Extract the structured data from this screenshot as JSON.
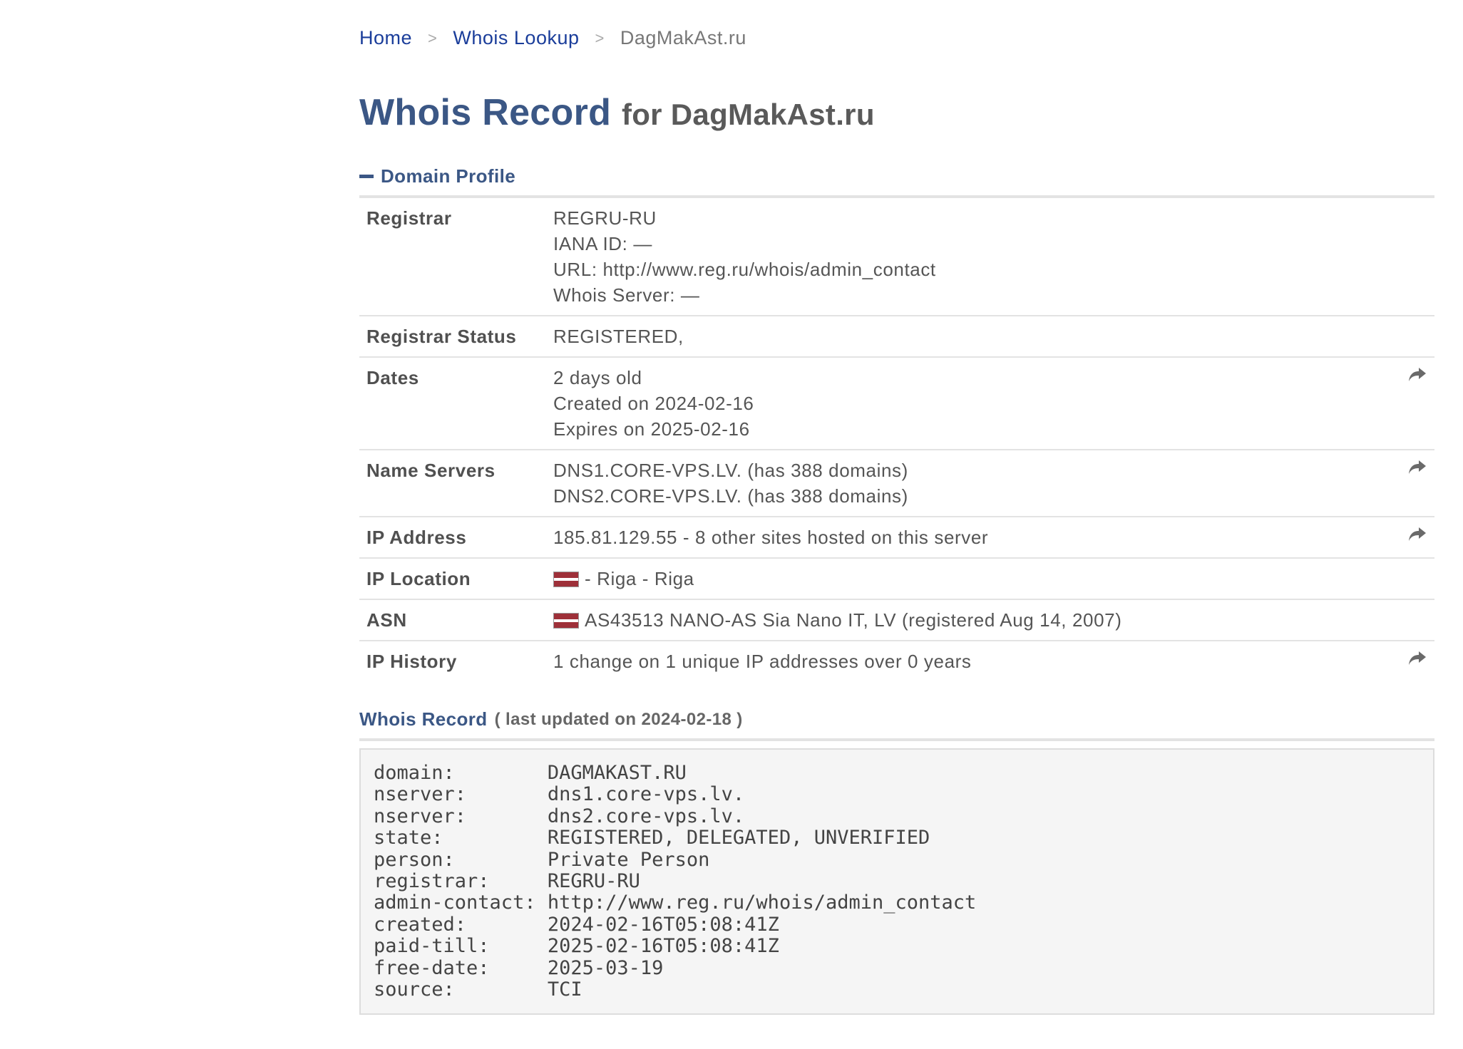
{
  "breadcrumb": {
    "home": "Home",
    "sep": ">",
    "whois_lookup": "Whois Lookup",
    "current": "DagMakAst.ru"
  },
  "title": {
    "main": "Whois Record",
    "sub": "for DagMakAst.ru"
  },
  "domain_profile": {
    "heading": "Domain Profile",
    "rows": {
      "registrar": {
        "label": "Registrar",
        "lines": [
          "REGRU-RU",
          "IANA ID: —",
          "URL: http://www.reg.ru/whois/admin_contact",
          "Whois Server: —"
        ]
      },
      "registrar_status": {
        "label": "Registrar Status",
        "value": "REGISTERED,"
      },
      "dates": {
        "label": "Dates",
        "lines": [
          "2 days old",
          "Created on 2024-02-16",
          "Expires on 2025-02-16"
        ]
      },
      "name_servers": {
        "label": "Name Servers",
        "lines": [
          "DNS1.CORE-VPS.LV. (has 388 domains)",
          "DNS2.CORE-VPS.LV. (has 388 domains)"
        ]
      },
      "ip_address": {
        "label": "IP Address",
        "value": "185.81.129.55 - 8 other sites hosted on this server"
      },
      "ip_location": {
        "label": "IP Location",
        "value": "- Riga - Riga"
      },
      "asn": {
        "label": "ASN",
        "value": "AS43513 NANO-AS Sia Nano IT, LV (registered Aug 14, 2007)"
      },
      "ip_history": {
        "label": "IP History",
        "value": "1 change on 1 unique IP addresses over 0 years"
      }
    }
  },
  "whois_record": {
    "heading": "Whois Record",
    "updated": "( last updated on 2024-02-18 )",
    "raw": "domain:        DAGMAKAST.RU\nnserver:       dns1.core-vps.lv.\nnserver:       dns2.core-vps.lv.\nstate:         REGISTERED, DELEGATED, UNVERIFIED\nperson:        Private Person\nregistrar:     REGRU-RU\nadmin-contact: http://www.reg.ru/whois/admin_contact\ncreated:       2024-02-16T05:08:41Z\npaid-till:     2025-02-16T05:08:41Z\nfree-date:     2025-03-19\nsource:        TCI"
  },
  "icons": {
    "share": "share-arrow-icon",
    "flag": "latvia-flag-icon",
    "collapse": "minus-icon"
  },
  "colors": {
    "link": "#1a3d9a",
    "heading": "#3b5785",
    "flag_red": "#9e3039"
  }
}
